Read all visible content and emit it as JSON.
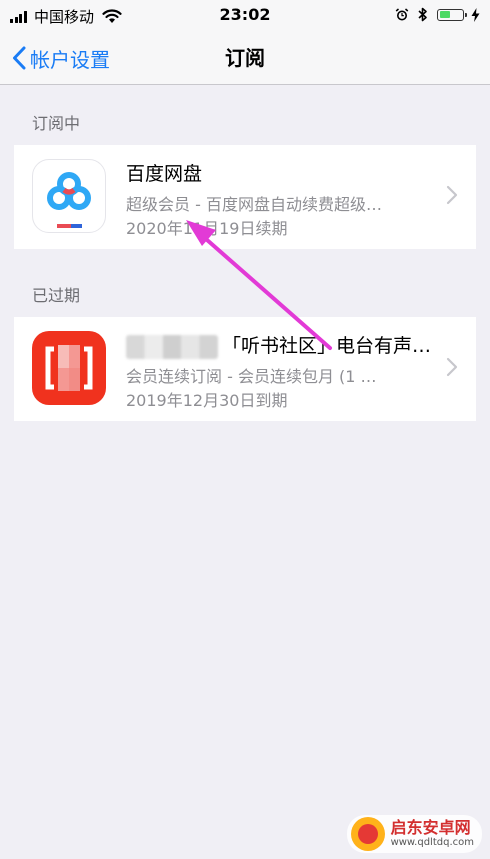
{
  "status_bar": {
    "carrier": "中国移动",
    "time": "23:02",
    "battery_level": 0.55
  },
  "nav": {
    "back_label": "帐户设置",
    "title": "订阅"
  },
  "sections": {
    "active_header": "订阅中",
    "expired_header": "已过期"
  },
  "active_items": [
    {
      "title": "百度网盘",
      "subtitle": "超级会员 - 百度网盘自动续费超级…",
      "date": "2020年11月19日续期"
    }
  ],
  "expired_items": [
    {
      "title": "「听书社区」电台有声…",
      "subtitle": "会员连续订阅 - 会员连续包月 (1 …",
      "date": "2019年12月30日到期"
    }
  ],
  "watermark": {
    "name": "启东安卓网",
    "url": "www.qdltdq.com"
  },
  "colors": {
    "accent": "#1a7cf5",
    "arrow": "#e23ad6",
    "background": "#f0eff5"
  }
}
